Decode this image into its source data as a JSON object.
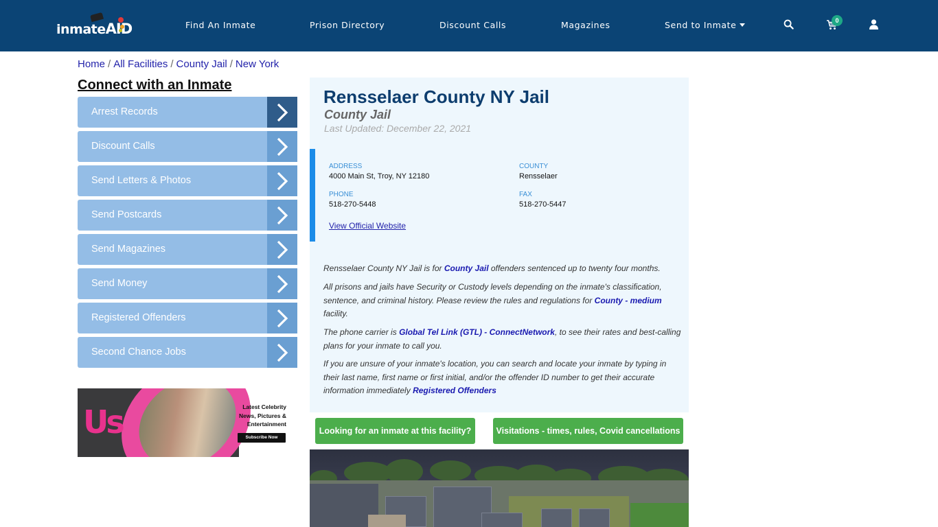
{
  "header": {
    "logo": {
      "text_left": "inmate",
      "text_right": "AID"
    },
    "nav": [
      {
        "label": "Find An Inmate"
      },
      {
        "label": "Prison Directory"
      },
      {
        "label": "Discount Calls"
      },
      {
        "label": "Magazines"
      },
      {
        "label": "Send to Inmate",
        "has_dropdown": true
      }
    ],
    "icons": [
      "search-icon",
      "cart-icon",
      "user-icon"
    ],
    "cart_count": "0"
  },
  "breadcrumb": [
    {
      "label": "Home"
    },
    {
      "label": "All Facilities"
    },
    {
      "label": "County Jail"
    },
    {
      "label": "New York"
    }
  ],
  "breadcrumb_separator": "/",
  "sidebar": {
    "title": "Connect with an Inmate",
    "items": [
      {
        "label": "Arrest Records"
      },
      {
        "label": "Discount Calls"
      },
      {
        "label": "Send Letters & Photos"
      },
      {
        "label": "Send Postcards"
      },
      {
        "label": "Send Magazines"
      },
      {
        "label": "Send Money"
      },
      {
        "label": "Registered Offenders"
      },
      {
        "label": "Second Chance Jobs"
      }
    ],
    "ad": {
      "brand": "Us",
      "headline": "Latest Celebrity News, Pictures & Entertainment",
      "button": "Subscribe Now"
    }
  },
  "facility": {
    "name": "Rensselaer County NY Jail",
    "type": "County Jail",
    "last_updated": "Last Updated: December 22, 2021",
    "address_label": "ADDRESS",
    "address": "4000 Main St, Troy, NY 12180",
    "county_label": "COUNTY",
    "county": "Rensselaer",
    "phone_label": "PHONE",
    "phone": "518-270-5448",
    "fax_label": "FAX",
    "fax": "518-270-5447",
    "website_link": "View Official Website"
  },
  "description": {
    "p1": {
      "before": "Rensselaer County NY Jail is for ",
      "link": "County Jail",
      "after": " offenders sentenced up to twenty four months."
    },
    "p2": {
      "before": "All prisons and jails have Security or Custody levels depending on the inmate's classification, sentence, and criminal history. Please review the rules and regulations for ",
      "link": "County - medium",
      "after": " facility."
    },
    "p3": {
      "before": "The phone carrier is ",
      "link": "Global Tel Link (GTL) - ConnectNetwork",
      "after": ", to see their rates and best-calling plans for your inmate to call you."
    },
    "p4": {
      "before": "If you are unsure of your inmate's location, you can search and locate your inmate by typing in their last name, first name or first initial, and/or the offender ID number to get their accurate information immediately ",
      "link": "Registered Offenders",
      "after": ""
    }
  },
  "buttons": {
    "find_inmate": "Looking for an inmate at this facility?",
    "visitations": "Visitations - times, rules, Covid cancellations"
  },
  "colors": {
    "header_bg": "#0b4475",
    "sidebar_item": "#94bde6",
    "sidebar_arrow": "#6a9fd2",
    "sidebar_arrow_active": "#2f5c8a",
    "card_bg": "#eef7fd",
    "accent_bar": "#1c8ce8",
    "button_green": "#4cae4c",
    "title_blue": "#0d3d6e",
    "link_blue": "#1a1ab0"
  }
}
